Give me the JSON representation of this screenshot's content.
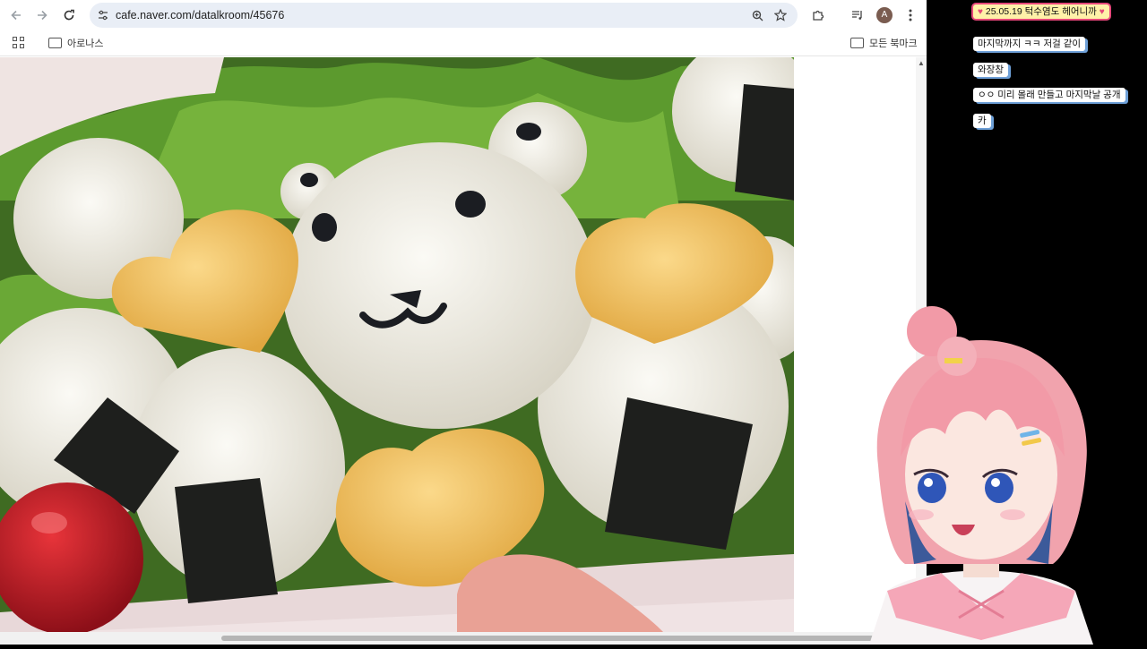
{
  "browser": {
    "url": "cafe.naver.com/datalkroom/45676",
    "profile_initial": "A",
    "bookmarks": {
      "folder": "아로나스",
      "all_bookmarks": "모든 북마크"
    }
  },
  "icons": {
    "back": "arrow-left-icon",
    "forward": "arrow-right-icon",
    "reload": "reload-icon",
    "site_info": "tune-icon",
    "zoom": "zoom-icon",
    "bookmark": "star-icon",
    "extensions": "puzzle-icon",
    "media": "media-control-icon",
    "menu": "kebab-menu-icon",
    "apps": "apps-grid-icon",
    "folder": "folder-icon"
  },
  "chat": {
    "pinned": "25.05.19 턱수염도 헤어니까",
    "messages": [
      "마지막까지 ㅋㅋ 저걸 같이",
      "와장창",
      "ㅇㅇ 미리 몰래 만들고 마지막날 공개",
      "카"
    ]
  },
  "colors": {
    "chat_border": "#6ea0d8",
    "pinned_bg": "#fff1a8",
    "pinned_border": "#e6477a",
    "omnibox_bg": "#e9eef6"
  }
}
